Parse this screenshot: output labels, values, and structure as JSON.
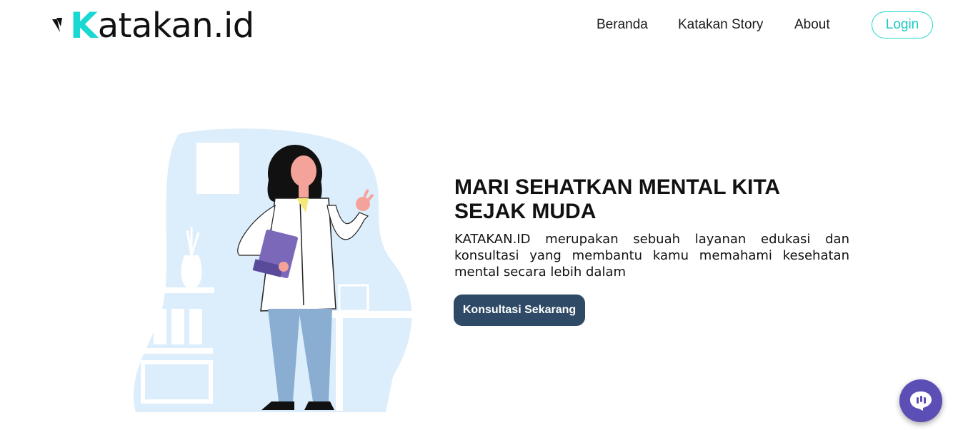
{
  "header": {
    "logo_text": "atakan.id",
    "logo_letter": "K",
    "nav": {
      "home": "Beranda",
      "story": "Katakan Story",
      "about": "About",
      "login": "Login"
    }
  },
  "hero": {
    "title_line1": "MARI SEHATKAN MENTAL KITA",
    "title_line2": "SEJAK MUDA",
    "description": "KATAKAN.ID merupakan sebuah layanan edukasi dan konsultasi yang membantu kamu memahami kesehatan mental secara lebih dalam",
    "cta_label": "Konsultasi Sekarang"
  },
  "icons": {
    "logo": "logo-mark-icon",
    "chat": "chat-bubble-icon"
  },
  "colors": {
    "accent": "#18d9d1",
    "cta": "#2f4a66",
    "chat": "#5b4fb5",
    "illustration_bg": "#dcedfb"
  }
}
